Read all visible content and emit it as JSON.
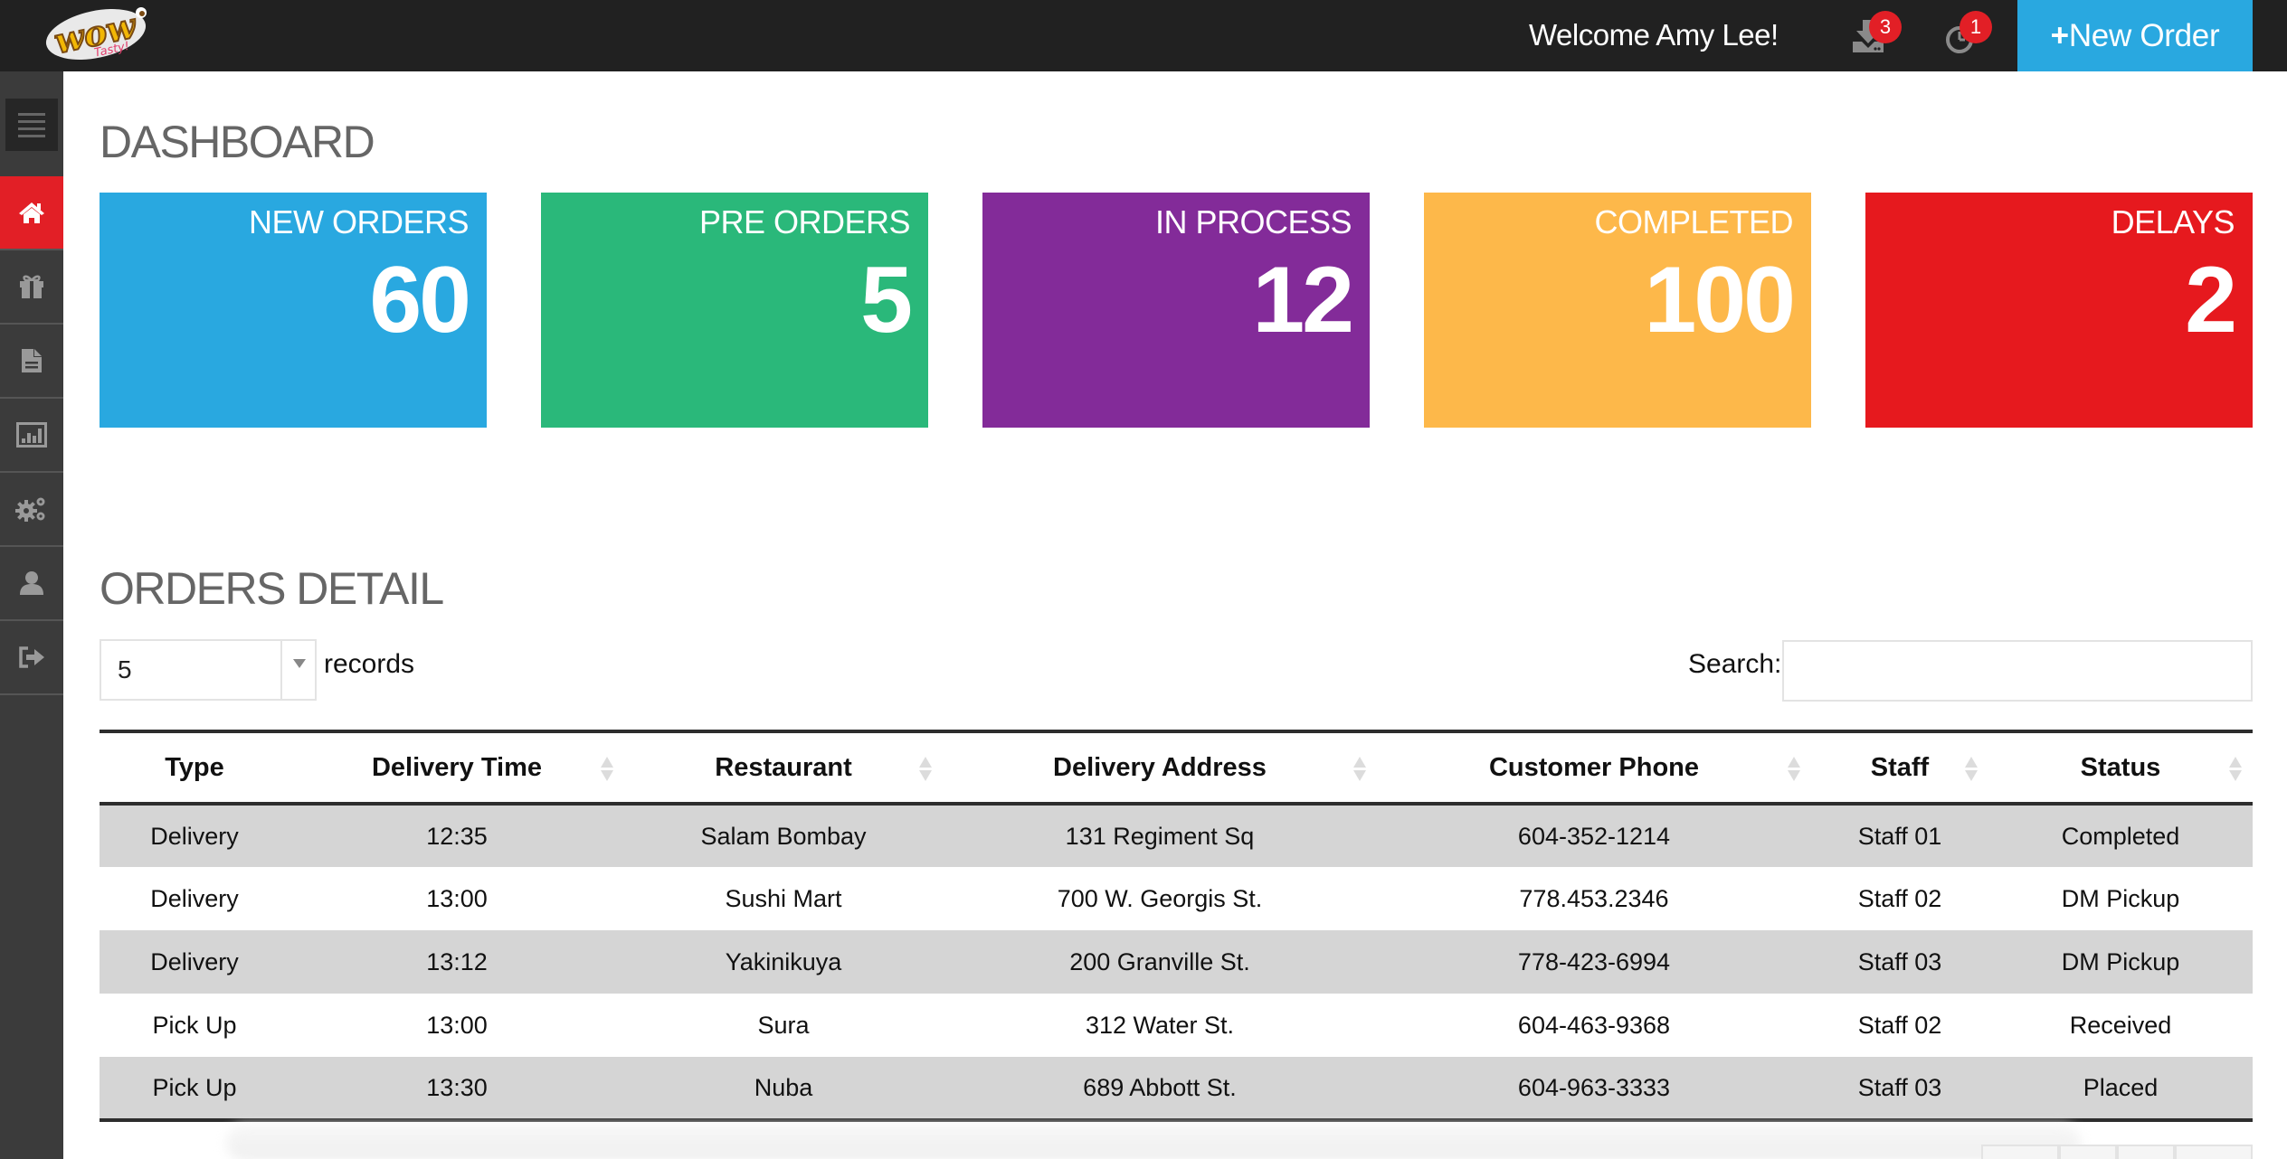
{
  "header": {
    "logo_alt": "WOW Tasty!",
    "welcome": "Welcome Amy Lee!",
    "notifications": [
      {
        "icon": "download-tray-icon",
        "count": "3"
      },
      {
        "icon": "clock-icon",
        "count": "1"
      }
    ],
    "new_order_plus": "+",
    "new_order_label": "New Order"
  },
  "sidebar": {
    "menu_icon": "hamburger-icon",
    "items": [
      {
        "name": "home",
        "icon": "home-icon",
        "active": true
      },
      {
        "name": "gifts",
        "icon": "gift-icon",
        "active": false
      },
      {
        "name": "documents",
        "icon": "file-icon",
        "active": false
      },
      {
        "name": "reports",
        "icon": "bar-chart-icon",
        "active": false
      },
      {
        "name": "settings",
        "icon": "gears-icon",
        "active": false
      },
      {
        "name": "profile",
        "icon": "user-icon",
        "active": false
      },
      {
        "name": "logout",
        "icon": "sign-out-icon",
        "active": false
      }
    ]
  },
  "dashboard": {
    "title": "DASHBOARD",
    "cards": [
      {
        "label": "NEW ORDERS",
        "value": "60",
        "color": "#29a8e0"
      },
      {
        "label": "PRE ORDERS",
        "value": "5",
        "color": "#2ab87a"
      },
      {
        "label": "IN PROCESS",
        "value": "12",
        "color": "#832b99"
      },
      {
        "label": "COMPLETED",
        "value": "100",
        "color": "#fdb84a"
      },
      {
        "label": "DELAYS",
        "value": "2",
        "color": "#e6191e"
      }
    ]
  },
  "orders": {
    "title": "ORDERS DETAIL",
    "page_length": "5",
    "records_label": "records",
    "search_label": "Search:",
    "search_value": "",
    "columns": [
      "Type",
      "Delivery Time",
      "Restaurant",
      "Delivery Address",
      "Customer Phone",
      "Staff",
      "Status"
    ],
    "rows": [
      [
        "Delivery",
        "12:35",
        "Salam Bombay",
        "131 Regiment Sq",
        "604-352-1214",
        "Staff 01",
        "Completed"
      ],
      [
        "Delivery",
        "13:00",
        "Sushi Mart",
        "700 W. Georgis St.",
        "778.453.2346",
        "Staff 02",
        "DM Pickup"
      ],
      [
        "Delivery",
        "13:12",
        "Yakinikuya",
        "200 Granville St.",
        "778-423-6994",
        "Staff 03",
        "DM Pickup"
      ],
      [
        "Pick Up",
        "13:00",
        "Sura",
        "312 Water St.",
        "604-463-9368",
        "Staff 02",
        "Received"
      ],
      [
        "Pick Up",
        "13:30",
        "Nuba",
        "689 Abbott St.",
        "604-963-3333",
        "Staff 03",
        "Placed"
      ]
    ]
  }
}
